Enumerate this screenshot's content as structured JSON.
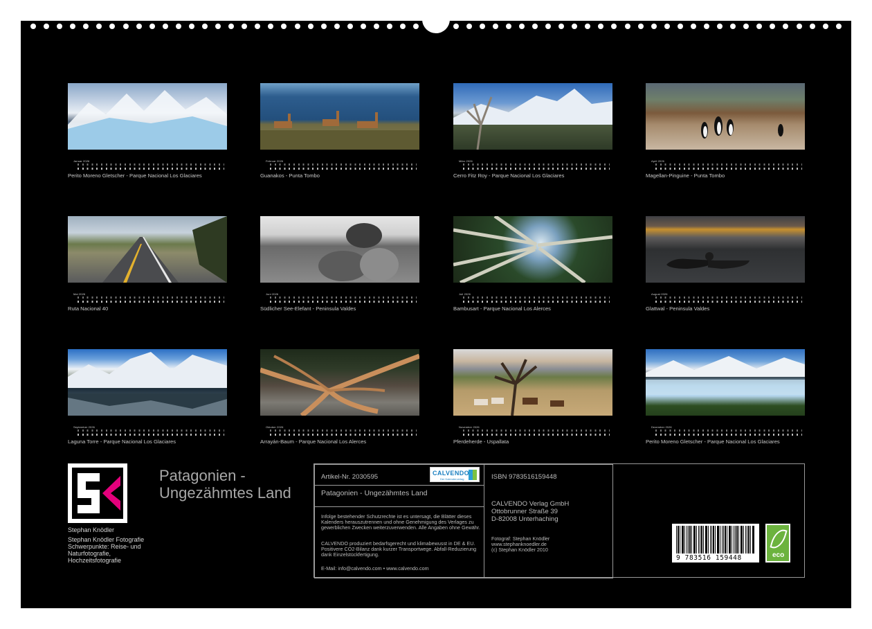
{
  "months": [
    {
      "name": "Januar 2026",
      "caption": "Perito Moreno Gletscher - Parque Nacional Los Glaciares",
      "photo_icon": "glacier-mountain-photo"
    },
    {
      "name": "Februar 2026",
      "caption": "Guanakos - Punta Tombo",
      "photo_icon": "guanacos-coast-photo"
    },
    {
      "name": "März 2026",
      "caption": "Cerro Fitz Roy - Parque Nacional Los Glaciares",
      "photo_icon": "fitz-roy-dead-tree-photo"
    },
    {
      "name": "April 2026",
      "caption": "Magellan-Pinguine - Punta Tombo",
      "photo_icon": "penguins-photo"
    },
    {
      "name": "Mai 2026",
      "caption": "Ruta Nacional 40",
      "photo_icon": "highway-photo"
    },
    {
      "name": "Juni 2026",
      "caption": "Südlicher See-Elefant - Peninsula Valdes",
      "photo_icon": "elephant-seals-photo"
    },
    {
      "name": "Juli 2026",
      "caption": "Bambusart - Parque Nacional Los Alerces",
      "photo_icon": "bamboo-forest-photo"
    },
    {
      "name": "August 2026",
      "caption": "Glattwal - Peninsula Valdes",
      "photo_icon": "whale-sunset-photo"
    },
    {
      "name": "September 2026",
      "caption": "Laguna Torre - Parque Nacional Los Glaciares",
      "photo_icon": "laguna-torre-photo"
    },
    {
      "name": "Oktober 2026",
      "caption": "Arrayán-Baum - Parque Nacional Los Alerces",
      "photo_icon": "arrayan-tree-photo"
    },
    {
      "name": "November 2026",
      "caption": "Pferdeherde - Uspallata",
      "photo_icon": "horses-photo"
    },
    {
      "name": "Dezember 2026",
      "caption": "Perito Moreno Gletscher - Parque Nacional Los Glaciares",
      "photo_icon": "glacier-front-photo"
    }
  ],
  "author": {
    "name": "Stephan Knödler",
    "description": "Stephan Knödler Fotografie Schwerpunkte: Reise- und Naturfotografie, Hochzeitsfotografie",
    "logo_icon": "sk-logo-icon"
  },
  "title": "Patagonien - Ungezähmtes Land",
  "imprint": {
    "article_no": "Artikel-Nr. 2030595",
    "title": "Patagonien - Ungezähmtes Land",
    "legal": "Infolge bestehender Schutzrechte ist es untersagt, die Blätter dieses Kalenders herauszutrennen und ohne Genehmigung des Verlages zu gewerblichen Zwecken weiterzuverwenden. Alle Angaben ohne Gewähr.",
    "eco_note": "CALVENDO produziert bedarfsgerecht und klimabewusst in DE & EU. Positivere CO2-Bilanz dank kurzer Transportwege. Abfall-Reduzierung dank Einzelstückfertigung.",
    "contact": "E-Mail: info@calvendo.com • www.calvendo.com",
    "isbn": "ISBN 9783516159448",
    "publisher_1": "CALVENDO Verlag GmbH",
    "publisher_2": "Ottobrunner Straße 39",
    "publisher_3": "D-82008 Unterhaching",
    "photographer_1": "Fotograf: Stephan Knödler",
    "photographer_2": "www.stephanknoedler.de",
    "photographer_3": "(c) Stephan Knödler 2010",
    "barcode_number": "9 783516 159448",
    "brand": "CALVENDO",
    "brand_sub": "Der Kalenderverlag",
    "eco_label": "eco"
  },
  "colors": {
    "background": "#000000",
    "text": "#c9c9c9",
    "logo_accent": "#e4007c",
    "calvendo_blue": "#1a7fc0",
    "eco_green": "#6cb33e"
  }
}
